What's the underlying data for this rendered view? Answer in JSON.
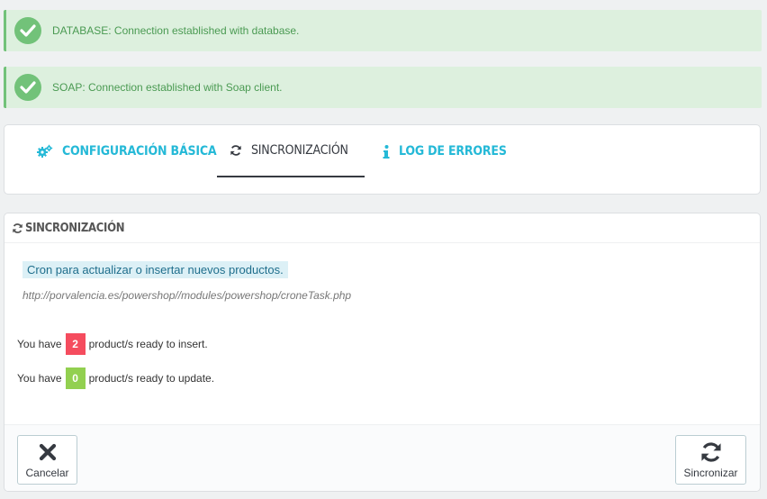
{
  "alerts": [
    {
      "icon": "check-circle-icon",
      "message": "DATABASE: Connection established with database."
    },
    {
      "icon": "check-circle-icon",
      "message": "SOAP: Connection established with Soap client."
    }
  ],
  "tabs": [
    {
      "icon": "gears-icon",
      "label": "CONFIGURACIÓN BÁSICA",
      "active": false
    },
    {
      "icon": "refresh-icon",
      "label": "SINCRONIZACIÓN",
      "active": true
    },
    {
      "icon": "info-icon",
      "label": "LOG DE ERRORES",
      "active": false
    }
  ],
  "panel": {
    "title": "SINCRONIZACIÓN",
    "cron_title": "Cron para actualizar o insertar nuevos productos.",
    "cron_url": "http://porvalencia.es/powershop//modules/powershop/croneTask.php",
    "insert": {
      "prefix": "You have",
      "count": "2",
      "suffix": "product/s ready to insert."
    },
    "update": {
      "prefix": "You have",
      "count": "0",
      "suffix": "product/s ready to update."
    },
    "cancel_label": "Cancelar",
    "sync_label": "Sincronizar"
  },
  "colors": {
    "success_bg": "#ddf0de",
    "success_accent": "#72c279",
    "link": "#25b9d7",
    "danger_badge": "#f54c5e",
    "ok_badge": "#92d050"
  }
}
